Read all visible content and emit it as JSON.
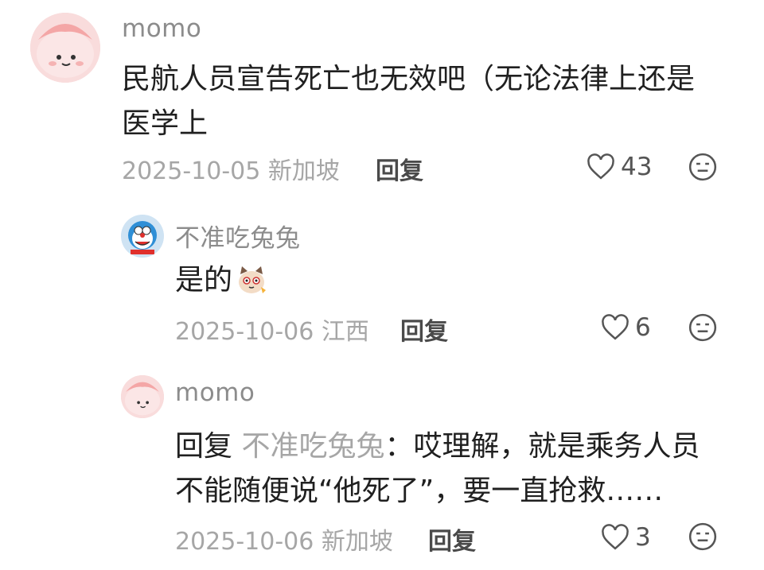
{
  "comments": [
    {
      "username": "momo",
      "text_line1": "民航人员宣告死亡也无效吧（无论法律上还是",
      "text_line2": "医学上",
      "date_location": "2025-10-05 新加坡",
      "reply_label": "回复",
      "likes": "43"
    },
    {
      "username": "不准吃兔兔",
      "text": "是的",
      "sticker": "cat-sticker-icon",
      "date_location": "2025-10-06 江西",
      "reply_label": "回复",
      "likes": "6"
    },
    {
      "username": "momo",
      "reply_prefix": "回复",
      "reply_target": "不准吃兔兔",
      "text_line1": "：哎理解，就是乘务人员",
      "text_line2": "不能随便说“他死了”，要一直抢救……",
      "date_location": "2025-10-06 新加坡",
      "reply_label": "回复",
      "likes": "3"
    }
  ],
  "colors": {
    "username": "#8c8c8c",
    "meta": "#a6a6a6",
    "avatar_pink": "#f7c9c9"
  }
}
